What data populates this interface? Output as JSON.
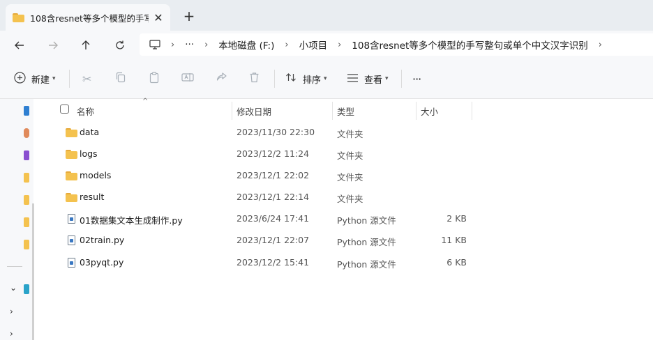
{
  "tab": {
    "title": "108含resnet等多个模型的手写整句或单个中文汉字识别",
    "close": "✕",
    "new_tab": "+"
  },
  "address": {
    "crumbs": [
      "本地磁盘 (F:)",
      "小项目",
      "108含resnet等多个模型的手写整句或单个中文汉字识别"
    ],
    "ellipsis": "···"
  },
  "toolbar": {
    "new_label": "新建",
    "sort_label": "排序",
    "view_label": "查看",
    "more": "···"
  },
  "columns": {
    "name": "名称",
    "date": "修改日期",
    "type": "类型",
    "size": "大小"
  },
  "files": [
    {
      "name": "data",
      "date": "2023/11/30 22:30",
      "type": "文件夹",
      "size": "",
      "kind": "folder"
    },
    {
      "name": "logs",
      "date": "2023/12/2 11:24",
      "type": "文件夹",
      "size": "",
      "kind": "folder"
    },
    {
      "name": "models",
      "date": "2023/12/1 22:02",
      "type": "文件夹",
      "size": "",
      "kind": "folder"
    },
    {
      "name": "result",
      "date": "2023/12/1 22:14",
      "type": "文件夹",
      "size": "",
      "kind": "folder"
    },
    {
      "name": "01数据集文本生成制作.py",
      "date": "2023/6/24 17:41",
      "type": "Python 源文件",
      "size": "2 KB",
      "kind": "python"
    },
    {
      "name": "02train.py",
      "date": "2023/12/1 22:07",
      "type": "Python 源文件",
      "size": "11 KB",
      "kind": "python"
    },
    {
      "name": "03pyqt.py",
      "date": "2023/12/2 15:41",
      "type": "Python 源文件",
      "size": "6 KB",
      "kind": "python"
    }
  ],
  "colors": {
    "folder": "#f4c24f",
    "python_icon": "#3a78c2",
    "chrome_bg": "#f7f8fa",
    "tabstrip_bg": "#e9edf1"
  }
}
